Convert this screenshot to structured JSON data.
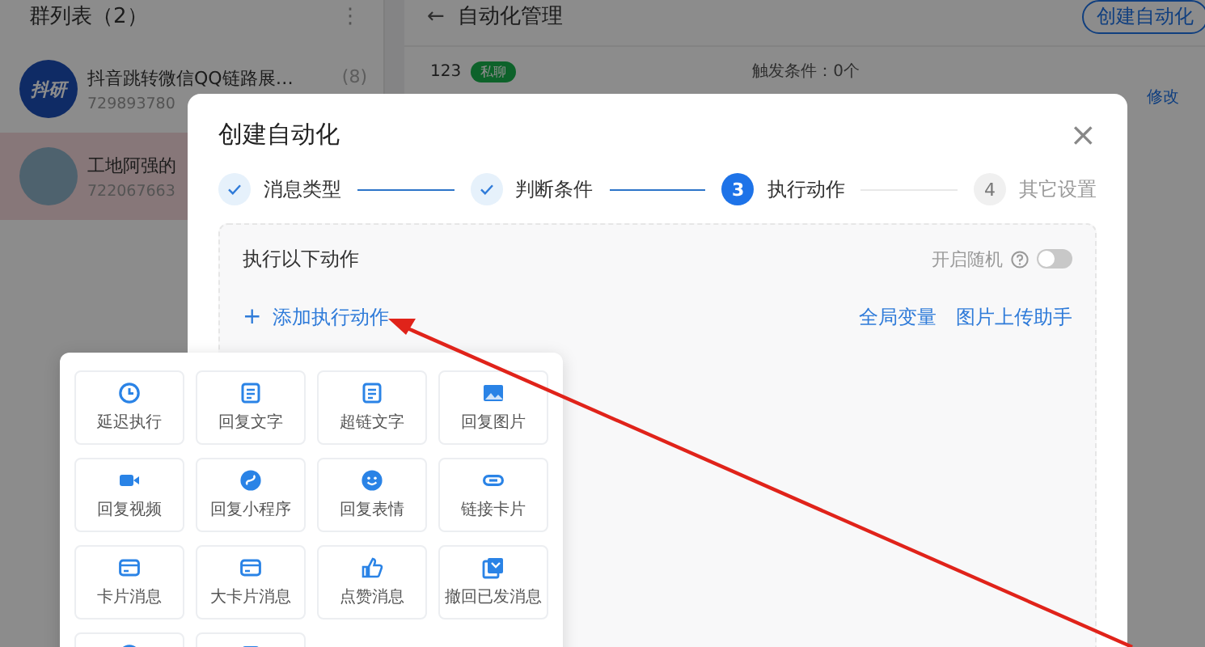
{
  "sidebar": {
    "title": "群列表（2）",
    "menu_glyph": "⋮",
    "items": [
      {
        "avatar_text": "抖研",
        "name": "抖音跳转微信QQ链路展…",
        "count": "(8)",
        "id": "729893780",
        "selected": false
      },
      {
        "name": "工地阿强的",
        "id": "722067663",
        "selected": true
      }
    ]
  },
  "main": {
    "back_glyph": "←",
    "title": "自动化管理",
    "create_button": "创建自动化",
    "rows": [
      {
        "name": "123",
        "tag": "私聊",
        "condition": "触发条件：0个",
        "action": "修改"
      }
    ]
  },
  "modal": {
    "title": "创建自动化",
    "close_glyph": "×",
    "steps": [
      {
        "label": "消息类型",
        "kind": "done"
      },
      {
        "label": "判断条件",
        "kind": "done"
      },
      {
        "label": "执行动作",
        "kind": "active",
        "number": "3"
      },
      {
        "label": "其它设置",
        "kind": "pending",
        "number": "4"
      }
    ],
    "section_title": "执行以下动作",
    "random_label": "开启随机",
    "random_on": false,
    "add_action": {
      "glyph": "+",
      "label": "添加执行动作"
    },
    "links": [
      "全局变量",
      "图片上传助手"
    ]
  },
  "action_menu": {
    "items": [
      {
        "kind": "tile",
        "label": "延迟执行"
      },
      {
        "kind": "tile",
        "label": "回复文字"
      },
      {
        "kind": "tile",
        "label": "超链文字"
      },
      {
        "kind": "tile",
        "label": "回复图片"
      },
      {
        "kind": "tile",
        "label": "回复视频"
      },
      {
        "kind": "tile",
        "label": "回复小程序"
      },
      {
        "kind": "tile",
        "label": "回复表情"
      },
      {
        "kind": "tile",
        "label": "链接卡片"
      },
      {
        "kind": "tile",
        "label": "卡片消息"
      },
      {
        "kind": "tile",
        "label": "大卡片消息"
      },
      {
        "kind": "tile",
        "label": "点赞消息"
      },
      {
        "kind": "tile",
        "label": "撤回已发消息"
      },
      {
        "kind": "clipped"
      },
      {
        "kind": "clipped"
      }
    ]
  }
}
